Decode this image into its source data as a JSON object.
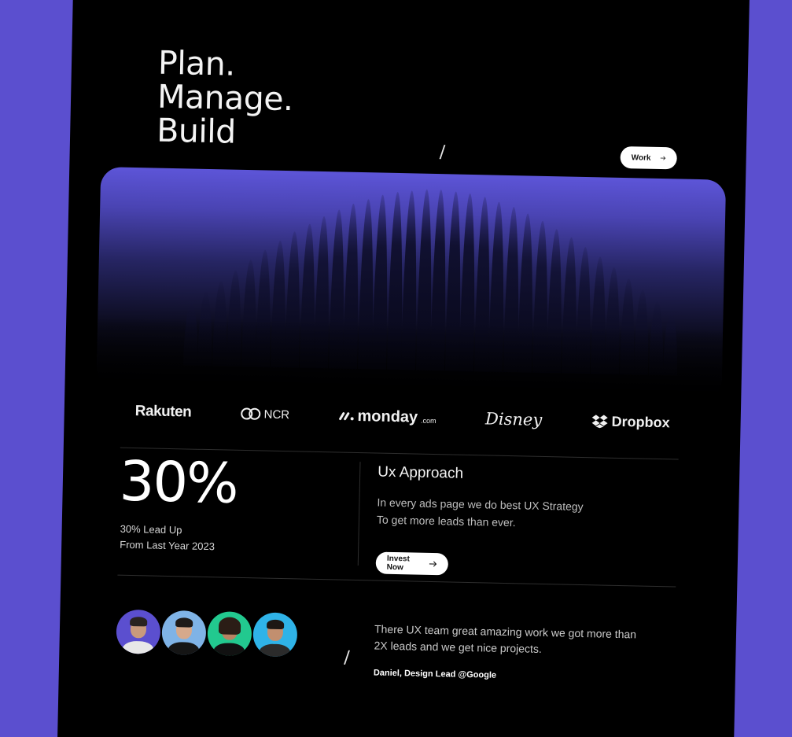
{
  "hero": {
    "title_lines": [
      "Plan.",
      "Manage.",
      "Build"
    ],
    "slash": "/"
  },
  "nav": {
    "work_label": "Work",
    "arrow_icon": "arrow-right-icon"
  },
  "logos": {
    "rakuten": "Rakuten",
    "ncr": "NCR",
    "monday": "monday",
    "monday_suffix": ".com",
    "disney": "Disney",
    "dropbox": "Dropbox"
  },
  "stats": {
    "value": "30%",
    "caption_lines": [
      "30% Lead Up",
      "From Last Year 2023"
    ]
  },
  "ux": {
    "title": "Ux Approach",
    "body_lines": [
      "In every ads page we do best UX Strategy",
      "To get more leads than ever."
    ],
    "cta_label": "Invest Now"
  },
  "testimonial": {
    "slash": "/",
    "quote_lines": [
      "There UX team great amazing work we got more than",
      "2X leads and we get nice projects."
    ],
    "author": "Daniel, Design Lead @Google",
    "avatar_colors": [
      "#5b4fcf",
      "#7fb3e6",
      "#22c98f",
      "#2fb3e8"
    ]
  },
  "colors": {
    "background": "#5b4fcf",
    "panel": "#000000",
    "accent": "#5d55d8"
  }
}
